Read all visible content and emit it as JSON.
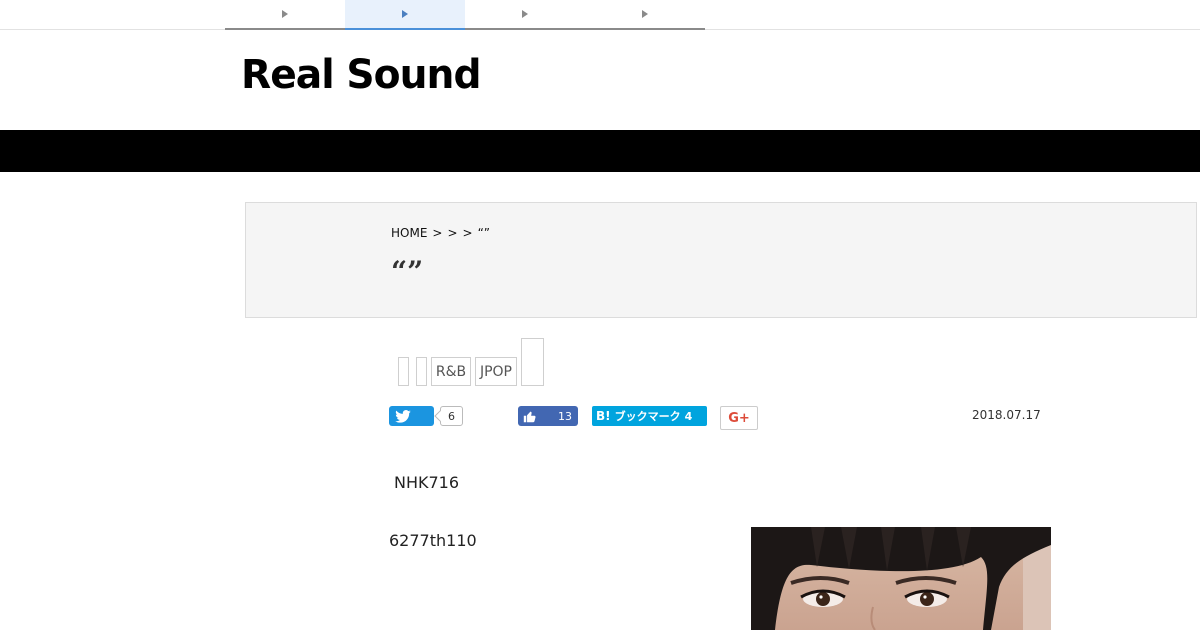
{
  "topnav": {
    "tabs": [
      {
        "label": ""
      },
      {
        "label": "",
        "active": true
      },
      {
        "label": ""
      },
      {
        "label": ""
      }
    ]
  },
  "logo": {
    "text": "Real Sound"
  },
  "breadcrumb": {
    "home": "HOME",
    "sep1": ">",
    "sep2": ">",
    "sep3": ">",
    "current": "“”"
  },
  "page": {
    "title": "“”"
  },
  "tags": [
    "",
    "",
    "R&B",
    "JPOP",
    ""
  ],
  "share": {
    "twitter_count": "6",
    "facebook_count": "13",
    "hatena_label": "ブックマーク",
    "hatena_count": "4",
    "hatena_prefix": "B!",
    "gplus_label": "G+"
  },
  "article": {
    "date": "2018.07.17",
    "paragraph1": "NHK716",
    "paragraph2": "6277th110"
  },
  "colors": {
    "twitter": "#1b95e0",
    "facebook": "#4267b2",
    "hatena": "#00a4de",
    "gplus": "#dd4b39",
    "band": "#000000"
  }
}
